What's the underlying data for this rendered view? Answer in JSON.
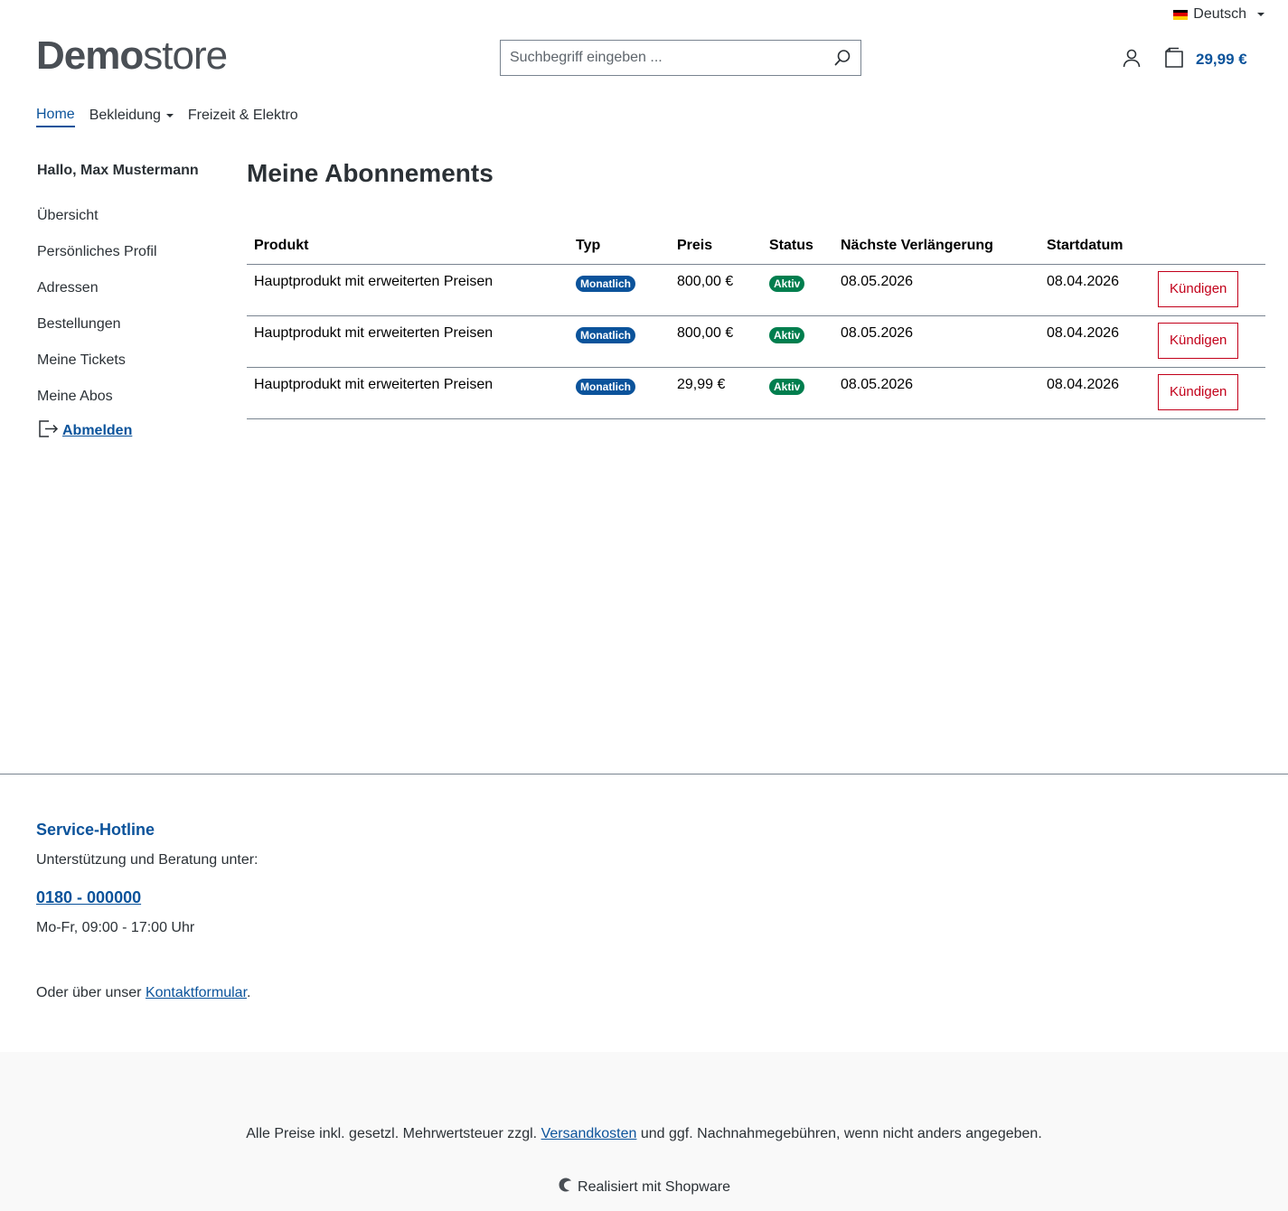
{
  "topbar": {
    "language": "Deutsch",
    "flag_colors": [
      "#000000",
      "#dd0000",
      "#ffce00"
    ]
  },
  "header": {
    "logo_bold": "Demo",
    "logo_light": "store",
    "search_placeholder": "Suchbegriff eingeben ...",
    "cart_total": "29,99 €"
  },
  "mainnav": {
    "items": [
      {
        "label": "Home",
        "active": true
      },
      {
        "label": "Bekleidung",
        "has_dropdown": true
      },
      {
        "label": "Freizeit & Elektro"
      }
    ]
  },
  "sidebar": {
    "greeting": "Hallo, Max Mustermann",
    "items": [
      {
        "label": "Übersicht"
      },
      {
        "label": "Persönliches Profil"
      },
      {
        "label": "Adressen"
      },
      {
        "label": "Bestellungen"
      },
      {
        "label": "Meine Tickets"
      },
      {
        "label": "Meine Abos"
      }
    ],
    "logout": "Abmelden"
  },
  "main": {
    "title": "Meine Abonnements",
    "table": {
      "headers": [
        "Produkt",
        "Typ",
        "Preis",
        "Status",
        "Nächste Verlängerung",
        "Startdatum",
        ""
      ],
      "rows": [
        {
          "product": "Hauptprodukt mit erweiterten Preisen",
          "type": "Monatlich",
          "price": "800,00 €",
          "status": "Aktiv",
          "next": "08.05.2026",
          "start": "08.04.2026",
          "action": "Kündigen"
        },
        {
          "product": "Hauptprodukt mit erweiterten Preisen",
          "type": "Monatlich",
          "price": "800,00 €",
          "status": "Aktiv",
          "next": "08.05.2026",
          "start": "08.04.2026",
          "action": "Kündigen"
        },
        {
          "product": "Hauptprodukt mit erweiterten Preisen",
          "type": "Monatlich",
          "price": "29,99 €",
          "status": "Aktiv",
          "next": "08.05.2026",
          "start": "08.04.2026",
          "action": "Kündigen"
        }
      ]
    }
  },
  "footer": {
    "hotline_title": "Service-Hotline",
    "hotline_text": "Unterstützung und Beratung unter:",
    "phone": "0180 - 000000",
    "hours": "Mo-Fr, 09:00 - 17:00 Uhr",
    "contact_prefix": "Oder über unser ",
    "contact_link": "Kontaktformular",
    "contact_suffix": ".",
    "vat_prefix": "Alle Preise inkl. gesetzl. Mehrwertsteuer zzgl. ",
    "vat_link": "Versandkosten",
    "vat_suffix": " und ggf. Nachnahmegebühren, wenn nicht anders angegeben.",
    "powered": "Realisiert mit Shopware"
  },
  "colors": {
    "accent": "#0b539b",
    "success": "#007e4e",
    "danger": "#c2001a"
  }
}
